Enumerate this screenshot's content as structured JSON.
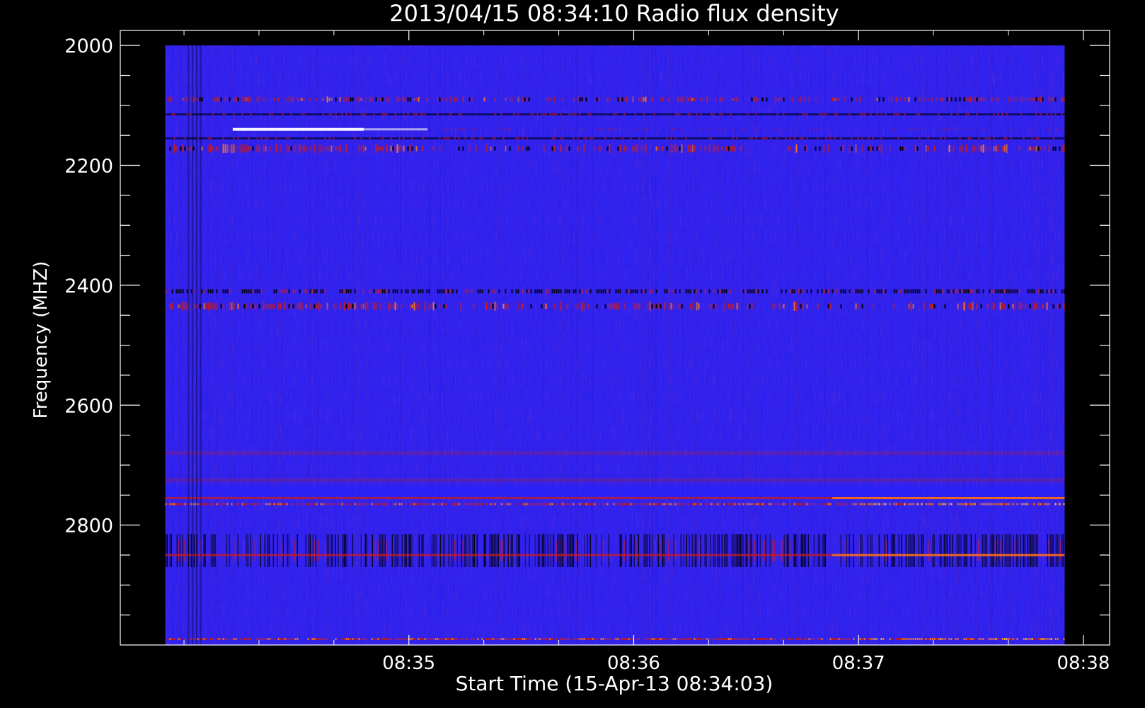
{
  "chart_data": {
    "type": "heatmap",
    "title": "2013/04/15 08:34:10 Radio flux density",
    "xlabel": "Start Time (15-Apr-13 08:34:03)",
    "ylabel": "Frequency (MHZ)",
    "x_ticks": [
      "08:35",
      "08:36",
      "08:37",
      "08:38"
    ],
    "x_tick_seconds": [
      57,
      117,
      177,
      237
    ],
    "x_range_seconds": [
      -20,
      244
    ],
    "data_range_seconds": [
      -8,
      232
    ],
    "y_ticks": [
      2000,
      2200,
      2400,
      2600,
      2800
    ],
    "ylim": [
      1975,
      3000
    ],
    "data_ylim": [
      2000,
      3000
    ],
    "y_inverted": true,
    "colors": {
      "background": "#000000",
      "base": "#2f22ee",
      "low": "#000000",
      "mid": "#cc1c1c",
      "high": "#ff7a18",
      "peak": "#ffffff"
    },
    "bands_mhz": [
      {
        "freq": 2090,
        "kind": "red-dashed"
      },
      {
        "freq": 2115,
        "kind": "dark-line"
      },
      {
        "freq": 2140,
        "kind": "white-burst"
      },
      {
        "freq": 2155,
        "kind": "dark-line"
      },
      {
        "freq": 2172,
        "kind": "red-band"
      },
      {
        "freq": 2410,
        "kind": "dark-dotted"
      },
      {
        "freq": 2435,
        "kind": "red-band"
      },
      {
        "freq": 2680,
        "kind": "faint-red"
      },
      {
        "freq": 2725,
        "kind": "faint-red"
      },
      {
        "freq": 2755,
        "kind": "red-line"
      },
      {
        "freq": 2765,
        "kind": "orange-line"
      },
      {
        "freq": 2840,
        "kind": "dark-striped"
      },
      {
        "freq": 2850,
        "kind": "red-line"
      },
      {
        "freq": 2990,
        "kind": "orange-line"
      }
    ]
  }
}
